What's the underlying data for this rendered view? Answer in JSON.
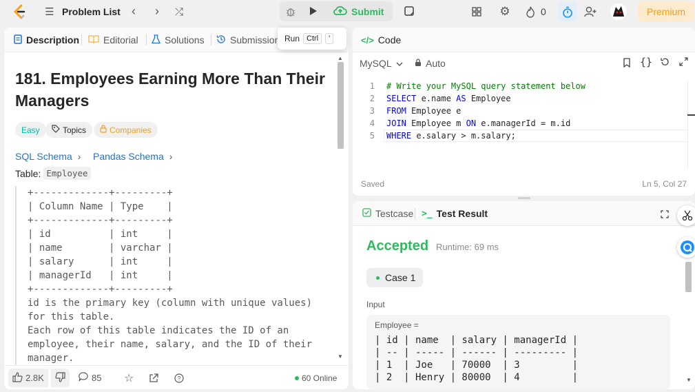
{
  "nav": {
    "problem_list": "Problem List",
    "submit": "Submit",
    "fire_count": "0",
    "premium": "Premium"
  },
  "tooltip": {
    "run": "Run",
    "key1": "Ctrl",
    "key2": "'"
  },
  "left_tabs": [
    "Description",
    "Editorial",
    "Solutions",
    "Submission"
  ],
  "problem": {
    "title": "181. Employees Earning More Than Their Managers",
    "difficulty": "Easy",
    "topics": "Topics",
    "companies": "Companies",
    "sql_schema": "SQL Schema",
    "pandas_schema": "Pandas Schema",
    "table_label": "Table:",
    "table_name": "Employee",
    "schema_lines": [
      "+-------------+---------+",
      "| Column Name | Type    |",
      "+-------------+---------+",
      "| id          | int     |",
      "| name        | varchar |",
      "| salary      | int     |",
      "| managerId   | int     |",
      "+-------------+---------+",
      "id is the primary key (column with unique values)",
      "for this table.",
      "Each row of this table indicates the ID of an",
      "employee, their name, salary, and the ID of their",
      "manager."
    ]
  },
  "bottom_bar": {
    "likes": "2.8K",
    "comments": "85",
    "online": "60 Online"
  },
  "code_panel": {
    "tab": "Code",
    "language": "MySQL",
    "auto": "Auto",
    "saved": "Saved",
    "cursor": "Ln 5, Col 27",
    "lines": [
      {
        "n": "1",
        "parts": [
          {
            "t": "# Write your MySQL query statement below",
            "c": "cm"
          }
        ]
      },
      {
        "n": "2",
        "parts": [
          {
            "t": "SELECT",
            "c": "kw"
          },
          {
            "t": " e.name ",
            "c": ""
          },
          {
            "t": "AS",
            "c": "kw"
          },
          {
            "t": " Employee",
            "c": ""
          }
        ]
      },
      {
        "n": "3",
        "parts": [
          {
            "t": "FROM",
            "c": "kw"
          },
          {
            "t": " Employee e",
            "c": ""
          }
        ]
      },
      {
        "n": "4",
        "parts": [
          {
            "t": "JOIN",
            "c": "kw"
          },
          {
            "t": " Employee m ",
            "c": ""
          },
          {
            "t": "ON",
            "c": "kw"
          },
          {
            "t": " e.managerId = m.id",
            "c": ""
          }
        ]
      },
      {
        "n": "5",
        "parts": [
          {
            "t": "WHERE",
            "c": "kw"
          },
          {
            "t": " e.salary > m.salary;",
            "c": ""
          }
        ]
      }
    ]
  },
  "result_panel": {
    "tab_testcase": "Testcase",
    "tab_result": "Test Result",
    "status": "Accepted",
    "runtime": "Runtime: 69 ms",
    "case": "Case 1",
    "input_label": "Input",
    "table_name": "Employee =",
    "table_lines": [
      "| id | name  | salary | managerId |",
      "| -- | ----- | ------ | --------- |",
      "| 1  | Joe   | 70000  | 3         |",
      "| 2  | Henry | 80000  | 4         |"
    ]
  },
  "colors": {
    "accent_green": "#2cbb5d",
    "link_blue": "#1a73d9",
    "premium": "#f59e0b",
    "easy": "#00b8a3",
    "timer_blue": "#1a90ff"
  }
}
